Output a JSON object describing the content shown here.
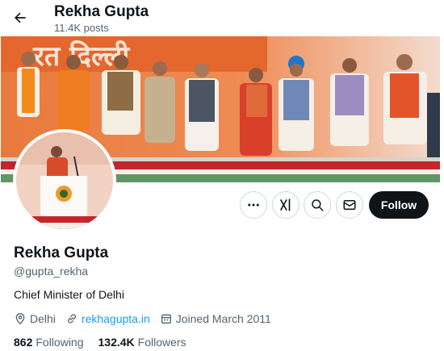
{
  "header": {
    "name": "Rekha Gupta",
    "post_count": "11.4K posts"
  },
  "banner": {
    "backdrop_text": "रत दिल्ली"
  },
  "profile": {
    "display_name": "Rekha Gupta",
    "handle": "@gupta_rekha",
    "bio": "Chief Minister of Delhi",
    "location": "Delhi",
    "website": "rekhagupta.in",
    "joined": "Joined March 2011",
    "following_count": "862",
    "following_label": "Following",
    "followers_count": "132.4K",
    "followers_label": "Followers"
  },
  "actions": {
    "follow_label": "Follow",
    "more_icon": "more-icon",
    "grok_icon": "grok-icon",
    "search_icon": "search-icon",
    "message_icon": "message-icon"
  },
  "colors": {
    "accent": "#1d9bf0",
    "text_primary": "#0f1419",
    "text_secondary": "#536471",
    "button_dark": "#0f1419",
    "border": "#cfd9de"
  }
}
